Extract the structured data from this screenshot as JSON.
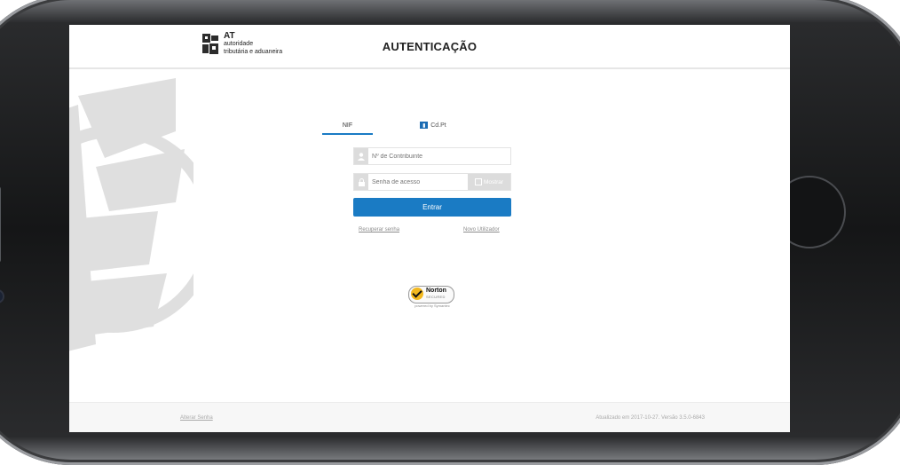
{
  "header": {
    "logo_at": "AT",
    "logo_line1": "autoridade",
    "logo_line2": "tributária e aduaneira",
    "title": "AUTENTICAÇÃO"
  },
  "tabs": [
    {
      "label": "NIF",
      "active": true
    },
    {
      "label": "Cd.Pt",
      "icon": "card-icon",
      "active": false
    }
  ],
  "login": {
    "nif_placeholder": "Nº de Contribuinte",
    "password_placeholder": "Senha de acesso",
    "show_label": "Mostrar",
    "submit_label": "Entrar",
    "recover_link": "Recuperar senha",
    "new_user_link": "Novo Utilizador"
  },
  "badge": {
    "name": "Norton",
    "sub": "SECURED",
    "powered": "powered by Symantec"
  },
  "footer": {
    "left_link": "Alterar Senha",
    "version": "Atualizado em 2017-10-27. Versão 3.5.0-6843"
  },
  "colors": {
    "accent": "#1a7bc4",
    "phone_frame": "#151617"
  }
}
